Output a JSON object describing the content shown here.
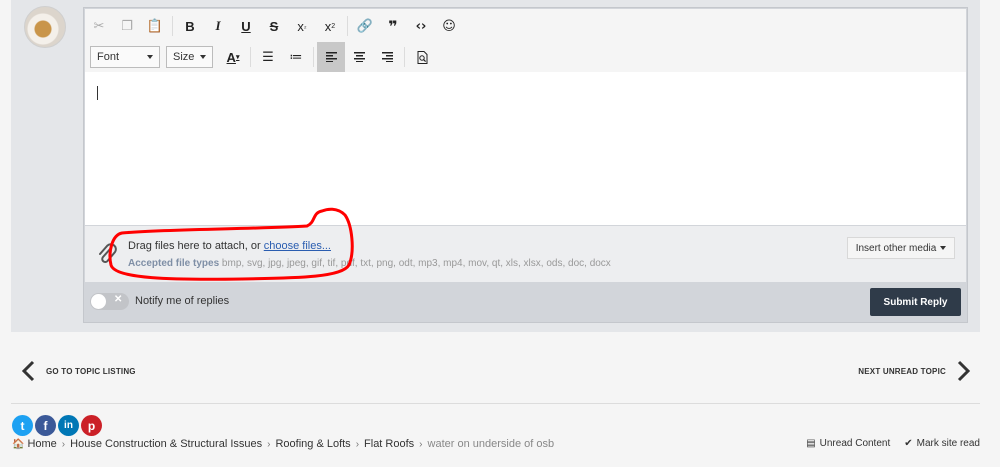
{
  "editor": {
    "toolbar": {
      "font_label": "Font",
      "size_label": "Size",
      "icons": [
        "cut-icon",
        "copy-icon",
        "paste-icon",
        "bold-icon",
        "italic-icon",
        "underline-icon",
        "strikethrough-icon",
        "subscript-icon",
        "superscript-icon",
        "link-icon",
        "quote-icon",
        "code-icon",
        "emoji-icon",
        "text-color-icon",
        "bullet-list-icon",
        "numbered-list-icon",
        "align-left-icon",
        "align-center-icon",
        "align-right-icon",
        "preview-icon"
      ]
    },
    "attach": {
      "drag_text": "Drag files here to attach, or ",
      "choose_link": "choose files...",
      "types_label": "Accepted file types",
      "types_list": " bmp, svg, jpg, jpeg, gif, tif, pdf, txt, png, odt, mp3, mp4, mov, qt, xls, xlsx, ods, doc, docx",
      "insert_media": "Insert other media"
    },
    "notify_label": "Notify me of replies",
    "submit_label": "Submit Reply"
  },
  "topic_nav": {
    "prev_label": "GO TO TOPIC LISTING",
    "next_label": "NEXT UNREAD TOPIC"
  },
  "social": {
    "twitter": "t",
    "facebook": "f",
    "linkedin": "in",
    "pinterest": "p"
  },
  "breadcrumb": {
    "items": [
      "Home",
      "House Construction & Structural Issues",
      "Roofing & Lofts",
      "Flat Roofs"
    ],
    "current": "water on underside of osb"
  },
  "footer": {
    "unread": "Unread Content",
    "mark_read": "Mark site read"
  },
  "colors": {
    "submit_bg": "#2f3b49",
    "link": "#2a5db0",
    "annotation": "#ff0000",
    "twitter": "#1da1f2",
    "facebook": "#3b5998",
    "linkedin": "#0077b5",
    "pinterest": "#cb2027"
  }
}
